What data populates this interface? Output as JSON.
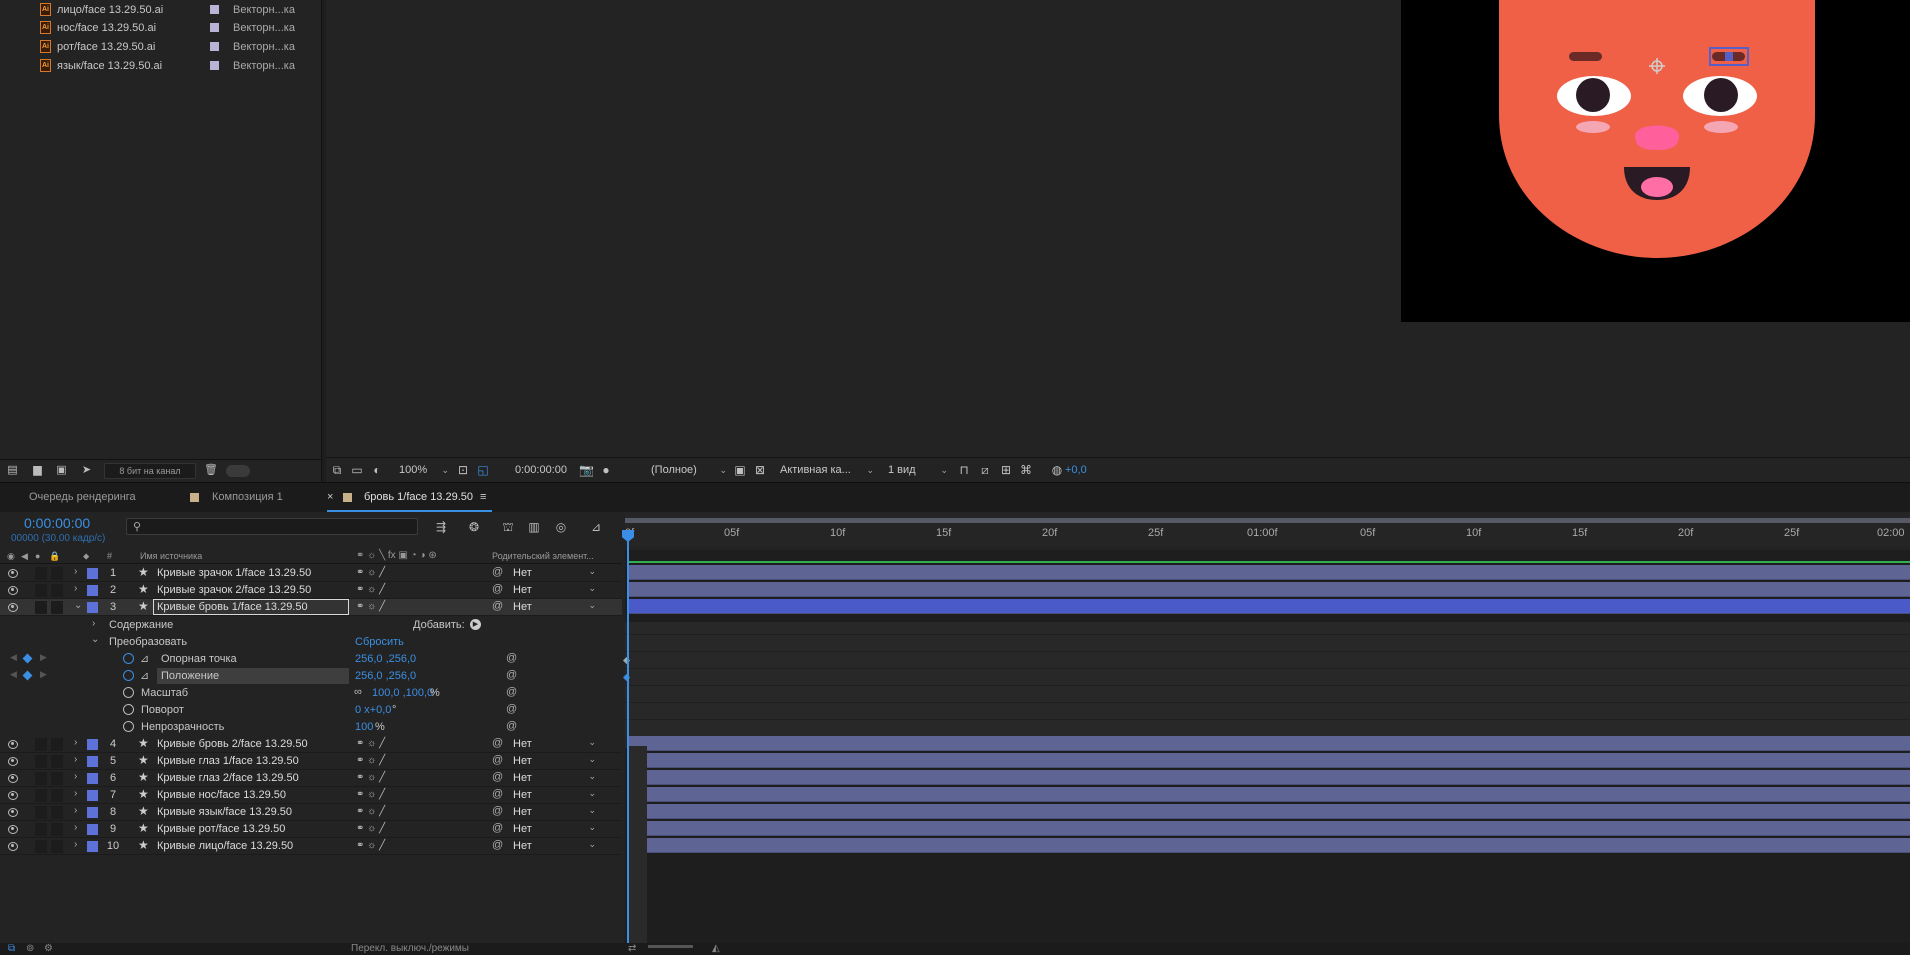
{
  "project": {
    "items": [
      {
        "name": "лицо/face 13.29.50.ai",
        "type": "Векторн...ка"
      },
      {
        "name": "нос/face 13.29.50.ai",
        "type": "Векторн...ка"
      },
      {
        "name": "рот/face 13.29.50.ai",
        "type": "Векторн...ка"
      },
      {
        "name": "язык/face 13.29.50.ai",
        "type": "Векторн...ка"
      }
    ],
    "bpc_label": "8 бит на канал"
  },
  "viewer": {
    "zoom": "100%",
    "timecode": "0:00:00:00",
    "resolution": "(Полное)",
    "camera": "Активная ка...",
    "views": "1 вид",
    "exposure": "+0,0"
  },
  "tabs": [
    {
      "label": "Очередь рендеринга"
    },
    {
      "label": "Композиция 1"
    },
    {
      "label": "бровь 1/face 13.29.50",
      "close": "×",
      "menu": "≡"
    }
  ],
  "timeline": {
    "timecode": "0:00:00:00",
    "frame_info": "00000 (30,00 кадр/с)",
    "col_source": "Имя источника",
    "col_parent": "Родительский элемент...",
    "col_hash": "#",
    "ruler": [
      "0f",
      "05f",
      "10f",
      "15f",
      "20f",
      "25f",
      "01:00f",
      "05f",
      "10f",
      "15f",
      "20f",
      "25f",
      "02:00"
    ],
    "layers_top": [
      {
        "num": "1",
        "name": "Кривые зрачок 1/face 13.29.50",
        "parent": "Нет"
      },
      {
        "num": "2",
        "name": "Кривые зрачок 2/face 13.29.50",
        "parent": "Нет"
      },
      {
        "num": "3",
        "name": "Кривые бровь 1/face 13.29.50",
        "parent": "Нет"
      }
    ],
    "group_contents": "Содержание",
    "add_label": "Добавить:",
    "group_transform": "Преобразовать",
    "reset": "Сбросить",
    "props": [
      {
        "label": "Опорная точка",
        "value": "256,0 ,256,0"
      },
      {
        "label": "Положение",
        "value": "256,0 ,256,0"
      },
      {
        "label": "Масштаб",
        "value": "100,0 ,100,0",
        "unit": "%"
      },
      {
        "label": "Поворот",
        "value": "0 x+0,0",
        "unit": "°"
      },
      {
        "label": "Непрозрачность",
        "value": "100",
        "unit": "%"
      }
    ],
    "layers_bottom": [
      {
        "num": "4",
        "name": "Кривые бровь 2/face 13.29.50",
        "parent": "Нет"
      },
      {
        "num": "5",
        "name": "Кривые глаз 1/face 13.29.50",
        "parent": "Нет"
      },
      {
        "num": "6",
        "name": "Кривые глаз 2/face 13.29.50",
        "parent": "Нет"
      },
      {
        "num": "7",
        "name": "Кривые нос/face 13.29.50",
        "parent": "Нет"
      },
      {
        "num": "8",
        "name": "Кривые язык/face 13.29.50",
        "parent": "Нет"
      },
      {
        "num": "9",
        "name": "Кривые рот/face 13.29.50",
        "parent": "Нет"
      },
      {
        "num": "10",
        "name": "Кривые лицо/face 13.29.50",
        "parent": "Нет"
      }
    ]
  },
  "status": {
    "toggle_label": "Перекл. выключ./режимы"
  },
  "colors": {
    "accent": "#3b8fe3",
    "layer_label": "#5c72d8",
    "face": "#ef6046"
  }
}
